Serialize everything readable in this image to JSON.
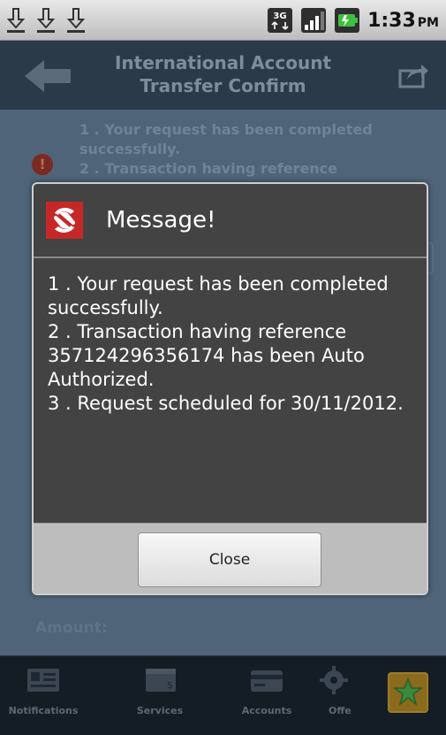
{
  "status_bar": {
    "time": "1:33",
    "ampm": "PM",
    "network": "3G",
    "icons": [
      "download-icon",
      "download-icon",
      "download-icon",
      "3g-icon",
      "signal-icon",
      "battery-icon"
    ]
  },
  "header": {
    "title": "International Account Transfer Confirm",
    "back_icon": "back-arrow-icon",
    "share_icon": "share-icon"
  },
  "background": {
    "messages": [
      "1 . Your request has been completed successfully.",
      "2 . Transaction having reference"
    ],
    "alert_glyph": "!",
    "amount_label": "Amount:"
  },
  "dialog": {
    "title": "Message!",
    "lines": [
      "1 . Your request has been completed successfully.",
      "2 . Transaction having reference 357124296356174 has been Auto Authorized.",
      "3 . Request scheduled for 30/11/2012."
    ],
    "close_label": "Close"
  },
  "bottom_nav": {
    "items": [
      {
        "label": "Notifications",
        "icon": "notification-card-icon"
      },
      {
        "label": "Services",
        "icon": "services-icon"
      },
      {
        "label": "Accounts",
        "icon": "accounts-card-icon"
      },
      {
        "label": "Offe",
        "icon": "offers-gear-icon"
      }
    ],
    "star_icon": "star-icon"
  },
  "colors": {
    "header_bg": "#2a3a49",
    "dialog_bg": "#434343",
    "star_bg": "#8a6a1d"
  }
}
